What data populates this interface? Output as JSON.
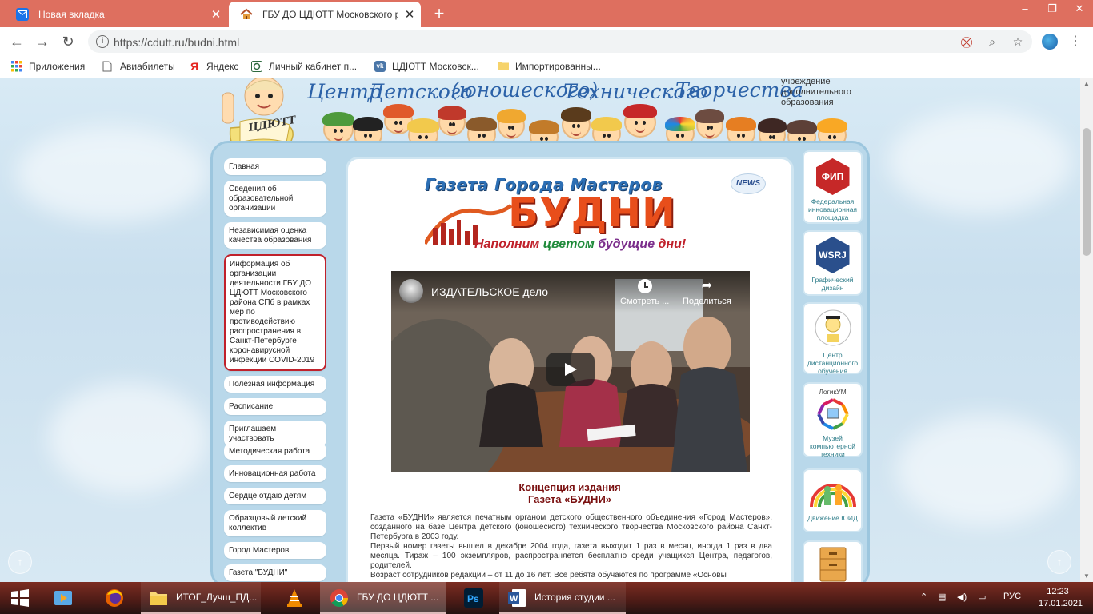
{
  "browser": {
    "tabs": [
      {
        "title": "Новая вкладка",
        "active": false
      },
      {
        "title": "ГБУ ДО ЦДЮТТ Московского р",
        "active": true
      }
    ],
    "url": "https://cdutt.ru/budni.html",
    "bookmarks": [
      {
        "label": "Приложения",
        "icon": "apps-grid-icon"
      },
      {
        "label": "Авиабилеты",
        "icon": "page-icon"
      },
      {
        "label": "Яндекс",
        "icon": "yandex-icon"
      },
      {
        "label": "Личный кабинет п...",
        "icon": "cabinet-icon"
      },
      {
        "label": "ЦДЮТТ Московск...",
        "icon": "vk-icon"
      },
      {
        "label": "Импортированны...",
        "icon": "folder-icon"
      }
    ]
  },
  "header": {
    "title_words": [
      "Центр",
      "Детского",
      "(юношеского)",
      "Технического",
      "Творчества"
    ],
    "subtitle_lines": [
      "учреждение",
      "дополнительного",
      "образования"
    ],
    "mascot_sign": "ЦДЮТТ"
  },
  "left_menu": {
    "items": [
      "Главная",
      "Сведения об образовательной организации",
      "Независимая оценка качества образования",
      "Информация об организации деятельности ГБУ ДО ЦДЮТТ Московского района СПб в рамках мер по противодействию распространения в Санкт-Петербурге коронавирусной инфекции COVID-2019",
      "Полезная информация",
      "Расписание",
      "Приглашаем участвовать",
      "Методическая работа",
      "Инновационная работа",
      "Сердце отдаю детям",
      "Образцовый детский коллектив",
      "Город Мастеров",
      "Газета \"БУДНИ\""
    ]
  },
  "main": {
    "logo_top": "Газета Города Мастеров",
    "logo_name": "БУДНИ",
    "logo_slogan_parts": [
      "Наполним",
      "цветом",
      "будущие",
      "дни!"
    ],
    "news_badge": "NEWS",
    "video": {
      "title": "ИЗДАТЕЛЬСКОЕ дело",
      "watch_later": "Смотреть ...",
      "share": "Поделиться"
    },
    "concept_title": "Концепция издания",
    "concept_subtitle": "Газета «БУДНИ»",
    "paragraphs": [
      "Газета «БУДНИ» является печатным органом детского общественного объединения «Город Мастеров», созданного на базе Центра детского (юношеского) технического творчества Московского района Санкт-Петербурга в 2003 году.",
      "Первый номер газеты вышел в декабре 2004 года,  газета выходит 1 раз в месяц, иногда 1 раз в два месяца. Тираж – 100 экземпляров, распространяется бесплатно среди учащихся Центра, педагогов, родителей.",
      "Возраст сотрудников редакции – от 11 до 16 лет. Все ребята обучаются по программе «Основы"
    ]
  },
  "right_sidebar": {
    "items": [
      {
        "badge": "ФИП",
        "label": "Федеральная инновационная площадка"
      },
      {
        "badge": "WSRJ",
        "label": "Графический дизайн"
      },
      {
        "badge": "",
        "label": "Центр дистанционного обучения"
      },
      {
        "badge": "ЛогикУМ",
        "label": "Музей компьютерной техники"
      },
      {
        "badge": "",
        "label": "Движение ЮИД"
      },
      {
        "badge": "",
        "label": ""
      }
    ]
  },
  "taskbar": {
    "apps": [
      {
        "label": "",
        "icon": "windows-start-icon"
      },
      {
        "label": "",
        "icon": "media-player-icon"
      },
      {
        "label": "",
        "icon": "firefox-icon"
      },
      {
        "label": "ИТОГ_Лучш_ПД...",
        "icon": "folder-icon"
      },
      {
        "label": "",
        "icon": "vlc-icon"
      },
      {
        "label": "ГБУ ДО ЦДЮТТ ...",
        "icon": "chrome-icon"
      },
      {
        "label": "",
        "icon": "photoshop-icon"
      },
      {
        "label": "История студии ...",
        "icon": "word-icon"
      }
    ],
    "language": "РУС",
    "time": "12:23",
    "date": "17.01.2021"
  },
  "colors": {
    "tabbar": "#de6f5f",
    "page_frame": "#b9d8ea",
    "menu_highlight_border": "#c0212b",
    "concept_title": "#7a1010",
    "sidebar_text": "#2f7d8a"
  }
}
